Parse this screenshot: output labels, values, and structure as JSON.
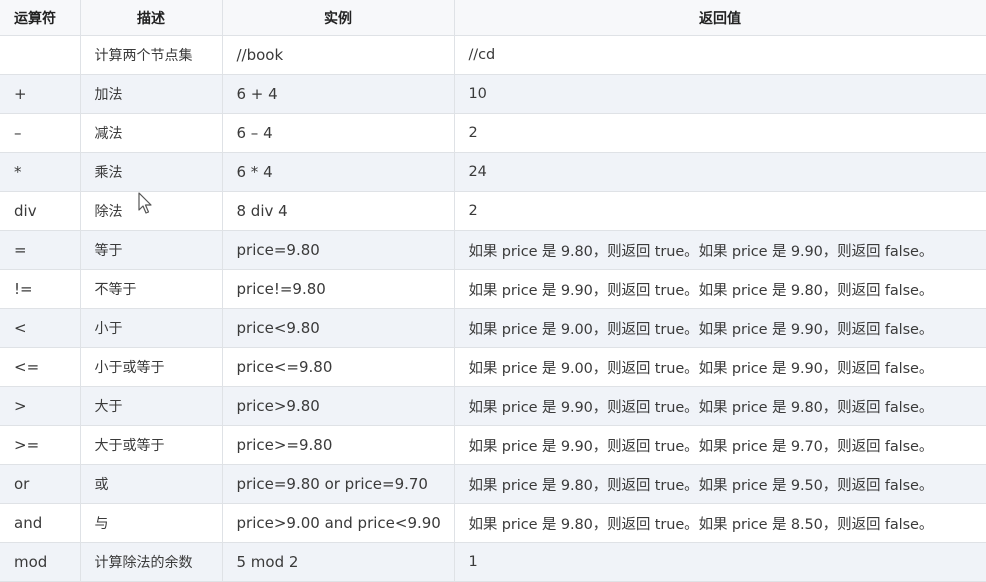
{
  "table": {
    "headers": {
      "operator": "运算符",
      "description": "描述",
      "example": "实例",
      "return_value": "返回值"
    },
    "rows": [
      {
        "operator": "",
        "description": "计算两个节点集",
        "example": "//book",
        "return_value": "//cd"
      },
      {
        "operator": "+",
        "description": "加法",
        "example": "6 + 4",
        "return_value": "10"
      },
      {
        "operator": "–",
        "description": "减法",
        "example": "6 – 4",
        "return_value": "2"
      },
      {
        "operator": "*",
        "description": "乘法",
        "example": "6 * 4",
        "return_value": "24"
      },
      {
        "operator": "div",
        "description": "除法",
        "example": "8 div 4",
        "return_value": "2"
      },
      {
        "operator": "=",
        "description": "等于",
        "example": "price=9.80",
        "return_value": "如果 price 是 9.80，则返回 true。如果 price 是 9.90，则返回 false。"
      },
      {
        "operator": "!=",
        "description": "不等于",
        "example": "price!=9.80",
        "return_value": "如果 price 是 9.90，则返回 true。如果 price 是 9.80，则返回 false。"
      },
      {
        "operator": "<",
        "description": "小于",
        "example": "price<9.80",
        "return_value": "如果 price 是 9.00，则返回 true。如果 price 是 9.90，则返回 false。"
      },
      {
        "operator": "<=",
        "description": "小于或等于",
        "example": "price<=9.80",
        "return_value": "如果 price 是 9.00，则返回 true。如果 price 是 9.90，则返回 false。"
      },
      {
        "operator": ">",
        "description": "大于",
        "example": "price>9.80",
        "return_value": "如果 price 是 9.90，则返回 true。如果 price 是 9.80，则返回 false。"
      },
      {
        "operator": ">=",
        "description": "大于或等于",
        "example": "price>=9.80",
        "return_value": "如果 price 是 9.90，则返回 true。如果 price 是 9.70，则返回 false。"
      },
      {
        "operator": "or",
        "description": "或",
        "example": "price=9.80 or price=9.70",
        "return_value": "如果 price 是 9.80，则返回 true。如果 price 是 9.50，则返回 false。"
      },
      {
        "operator": "and",
        "description": "与",
        "example": "price>9.00 and price<9.90",
        "return_value": "如果 price 是 9.80，则返回 true。如果 price 是 8.50，则返回 false。"
      },
      {
        "operator": "mod",
        "description": "计算除法的余数",
        "example": "5 mod 2",
        "return_value": "1"
      }
    ]
  },
  "colors": {
    "header_bg": "#f7f8fa",
    "row_stripe": "#f0f3f8",
    "border": "#dfe2e6",
    "text": "#3a3a3a"
  },
  "icons": {
    "cursor": "mouse-pointer-icon"
  }
}
